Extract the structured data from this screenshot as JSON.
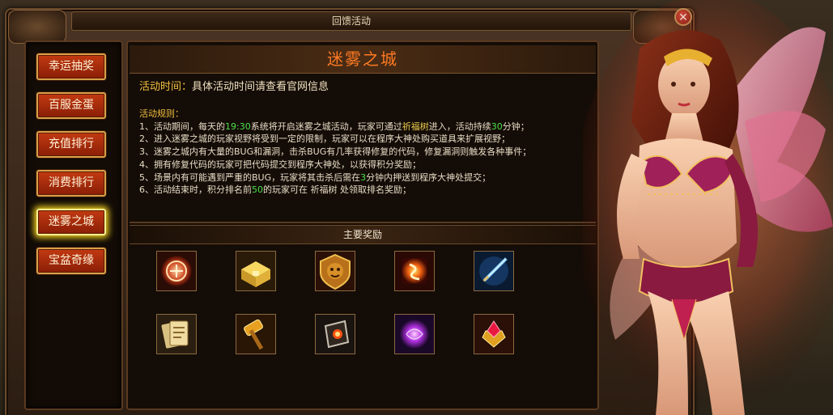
{
  "window": {
    "title": "回馈活动",
    "close_label": "✕"
  },
  "menu": {
    "items": [
      {
        "label": "幸运抽奖",
        "active": false
      },
      {
        "label": "百服金蛋",
        "active": false
      },
      {
        "label": "充值排行",
        "active": false
      },
      {
        "label": "消费排行",
        "active": false
      },
      {
        "label": "迷雾之城",
        "active": true
      },
      {
        "label": "宝盆奇缘",
        "active": false
      }
    ]
  },
  "event": {
    "title": "迷雾之城",
    "time_label": "活动时间：",
    "time_value": "具体活动时间请查看官网信息",
    "rules_heading": "活动规则：",
    "rules": [
      {
        "a": "1、活动期间，每天的",
        "b": "19:30",
        "c": "系统将开启迷雾之城活动，玩家可通过",
        "d": "祈福树",
        "e": "进入，活动持续",
        "f": "30",
        "g": "分钟；"
      },
      {
        "a": "2、进入迷雾之城的玩家视野将受到一定的限制，玩家可以在程序大神处购买道具来扩展视野；"
      },
      {
        "a": "3、迷雾之城内有大量的BUG和漏洞，击杀BUG有几率获得修复的代码，修复漏洞则触发各种事件；"
      },
      {
        "a": "4、拥有修复代码的玩家可把代码提交到程序大神处，以获得积分奖励；"
      },
      {
        "a": "5、场景内有可能遇到严重的BUG，玩家将其击杀后需在",
        "b": "3",
        "c": "分钟内押送到程序大神处提交；"
      },
      {
        "a": "6、活动结束时，积分排名前",
        "b": "50",
        "c": "的玩家可在 祈福树 处领取排名奖励；"
      }
    ],
    "rewards_title": "主要奖励",
    "reward_icons": [
      "rune-orb-icon",
      "gold-chest-icon",
      "lion-shield-icon",
      "fire-rune-icon",
      "ice-sword-icon",
      "scroll-cards-icon",
      "golden-hammer-icon",
      "dark-crystal-icon",
      "purple-orb-icon",
      "ruby-treasure-icon"
    ]
  },
  "colors": {
    "heading": "#ff7a24",
    "highlight_green": "#4ae04a",
    "highlight_yellow": "#f2c040",
    "menu_button": "#c23a12",
    "active_glow": "#f0d020"
  }
}
